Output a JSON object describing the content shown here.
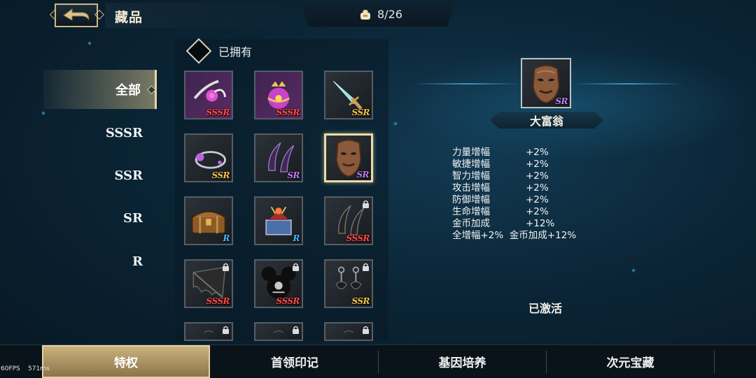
{
  "header": {
    "title": "藏品",
    "collection_count": "8/26"
  },
  "categories": [
    {
      "label": "全部",
      "active": true
    },
    {
      "label": "SSSR",
      "active": false
    },
    {
      "label": "SSR",
      "active": false
    },
    {
      "label": "SR",
      "active": false
    },
    {
      "label": "R",
      "active": false
    }
  ],
  "filter": {
    "owned_label": "已拥有"
  },
  "items": [
    {
      "icon": "pink-flower-brooch",
      "rarity": "SSSR",
      "locked": false
    },
    {
      "icon": "jeweled-orb-crown",
      "rarity": "SSSR",
      "locked": false
    },
    {
      "icon": "crystal-dagger",
      "rarity": "SSR",
      "locked": false
    },
    {
      "icon": "ring-bracelet",
      "rarity": "SSR",
      "locked": false
    },
    {
      "icon": "purple-claws",
      "rarity": "SR",
      "locked": false
    },
    {
      "icon": "bronze-mask",
      "rarity": "SR",
      "locked": false,
      "selected": true
    },
    {
      "icon": "treasure-chest",
      "rarity": "R",
      "locked": false
    },
    {
      "icon": "ornate-altar",
      "rarity": "R",
      "locked": false
    },
    {
      "icon": "dark-claws",
      "rarity": "SSSR",
      "locked": true
    },
    {
      "icon": "bat-wing",
      "rarity": "SSSR",
      "locked": true
    },
    {
      "icon": "skull-ears",
      "rarity": "SSSR",
      "locked": true
    },
    {
      "icon": "earrings",
      "rarity": "SSR",
      "locked": true
    },
    {
      "icon": "locked-item",
      "rarity": "",
      "locked": true
    },
    {
      "icon": "locked-item",
      "rarity": "",
      "locked": true
    },
    {
      "icon": "locked-item",
      "rarity": "",
      "locked": true
    }
  ],
  "detail": {
    "rarity": "SR",
    "name": "大富翁",
    "stats": [
      {
        "label": "力量增幅",
        "value": "+2%"
      },
      {
        "label": "敏捷增幅",
        "value": "+2%"
      },
      {
        "label": "智力增幅",
        "value": "+2%"
      },
      {
        "label": "攻击增幅",
        "value": "+2%"
      },
      {
        "label": "防御增幅",
        "value": "+2%"
      },
      {
        "label": "生命增幅",
        "value": "+2%"
      },
      {
        "label": "金币加成",
        "value": "+12%"
      }
    ],
    "summary": "全增幅+2%  金币加成+12%",
    "status": "已激活"
  },
  "tabs": [
    {
      "label": "特权",
      "active": true
    },
    {
      "label": "首领印记",
      "active": false
    },
    {
      "label": "基因培养",
      "active": false
    },
    {
      "label": "次元宝藏",
      "active": false
    }
  ],
  "debug": {
    "fps": "60FPS",
    "ms": "571ms"
  },
  "colors": {
    "SSSR": "#ff4848",
    "SSR": "#f0c24a",
    "SR": "#c07cf0",
    "R": "#4ab8f2",
    "gold_accent": "#cdb883"
  }
}
